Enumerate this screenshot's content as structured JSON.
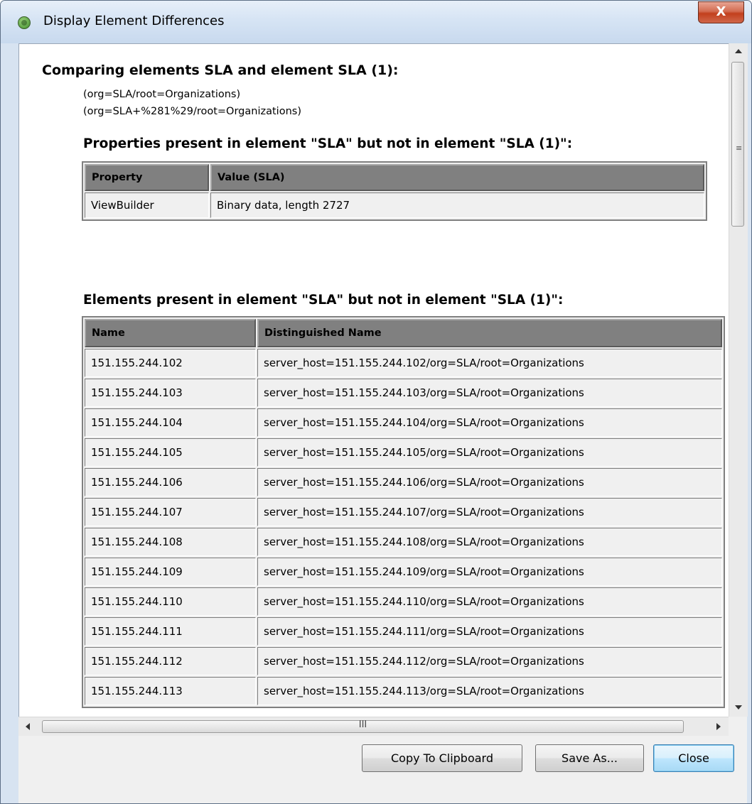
{
  "window": {
    "title": "Display Element Differences",
    "close_glyph": "X"
  },
  "heading": "Comparing elements SLA and element SLA (1):",
  "paths": [
    "(org=SLA/root=Organizations)",
    "(org=SLA+%281%29/root=Organizations)"
  ],
  "properties_section": {
    "heading": "Properties present in element \"SLA\" but not in element \"SLA (1)\":",
    "columns": [
      "Property",
      "Value (SLA)"
    ],
    "rows": [
      [
        "ViewBuilder",
        "Binary data, length 2727"
      ]
    ]
  },
  "elements_section": {
    "heading": "Elements present in element \"SLA\" but not in element \"SLA (1)\":",
    "columns": [
      "Name",
      "Distinguished Name"
    ],
    "rows": [
      [
        "151.155.244.102",
        "server_host=151.155.244.102/org=SLA/root=Organizations"
      ],
      [
        "151.155.244.103",
        "server_host=151.155.244.103/org=SLA/root=Organizations"
      ],
      [
        "151.155.244.104",
        "server_host=151.155.244.104/org=SLA/root=Organizations"
      ],
      [
        "151.155.244.105",
        "server_host=151.155.244.105/org=SLA/root=Organizations"
      ],
      [
        "151.155.244.106",
        "server_host=151.155.244.106/org=SLA/root=Organizations"
      ],
      [
        "151.155.244.107",
        "server_host=151.155.244.107/org=SLA/root=Organizations"
      ],
      [
        "151.155.244.108",
        "server_host=151.155.244.108/org=SLA/root=Organizations"
      ],
      [
        "151.155.244.109",
        "server_host=151.155.244.109/org=SLA/root=Organizations"
      ],
      [
        "151.155.244.110",
        "server_host=151.155.244.110/org=SLA/root=Organizations"
      ],
      [
        "151.155.244.111",
        "server_host=151.155.244.111/org=SLA/root=Organizations"
      ],
      [
        "151.155.244.112",
        "server_host=151.155.244.112/org=SLA/root=Organizations"
      ],
      [
        "151.155.244.113",
        "server_host=151.155.244.113/org=SLA/root=Organizations"
      ]
    ]
  },
  "scrollbar": {
    "grip_glyph": "≡",
    "h_grip_glyph": "III"
  },
  "buttons": {
    "copy": "Copy To Clipboard",
    "save_as": "Save As...",
    "close": "Close"
  }
}
